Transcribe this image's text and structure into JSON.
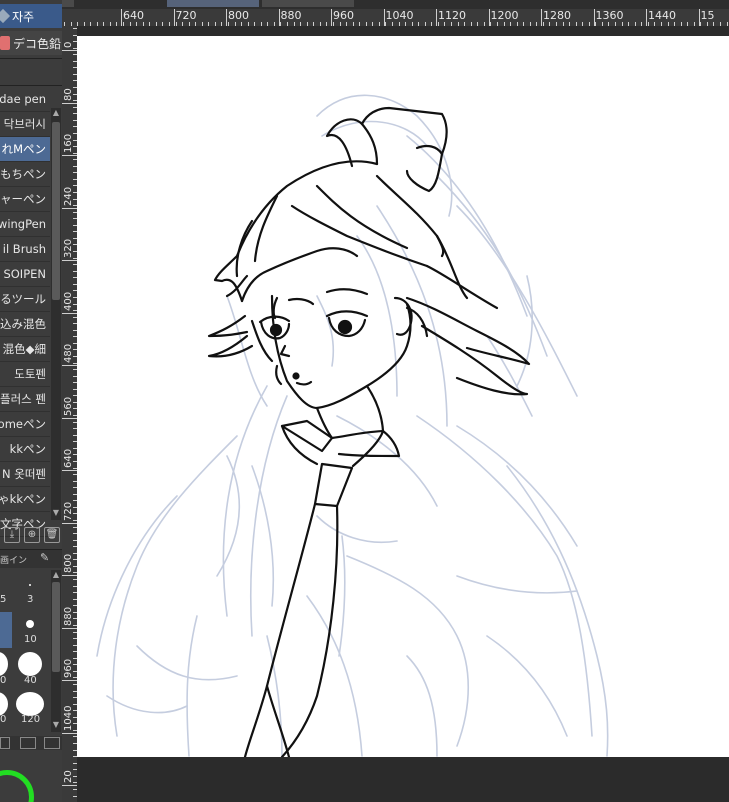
{
  "panel_tabs": {
    "top_label": "자주",
    "sub_label": "デコ色鉛"
  },
  "brushes": [
    {
      "label": "dae pen",
      "active": false
    },
    {
      "label": "닥브러시",
      "active": false
    },
    {
      "label": "れMペン",
      "active": true
    },
    {
      "label": "もちペン",
      "active": false
    },
    {
      "label": "ャーペン",
      "active": false
    },
    {
      "label": "wingPen",
      "active": false
    },
    {
      "label": "il Brush",
      "active": false
    },
    {
      "label": "SOIPEN",
      "active": false
    },
    {
      "label": "るツール",
      "active": false
    },
    {
      "label": "込み混色",
      "active": false
    },
    {
      "label": "混色◆細",
      "active": false
    },
    {
      "label": "도토펜",
      "active": false
    },
    {
      "label": "플러스 펜",
      "active": false
    },
    {
      "label": "omeペン",
      "active": false
    },
    {
      "label": "kkペン",
      "active": false
    },
    {
      "label": "N 옷떠펜",
      "active": false
    },
    {
      "label": "ゃkkペン",
      "active": false
    },
    {
      "label": "文字ペン",
      "active": false
    }
  ],
  "brush_size_panel": {
    "tab_label": "画イン",
    "sizes": [
      "5",
      "3",
      "10",
      "40",
      "0",
      "120",
      "0"
    ]
  },
  "ruler_top": [
    "640",
    "720",
    "800",
    "880",
    "960",
    "1040",
    "1120",
    "1200",
    "1280",
    "1360",
    "1440",
    "15"
  ],
  "ruler_left": [
    "0",
    "80",
    "160",
    "240",
    "320",
    "400",
    "480",
    "560",
    "640",
    "720",
    "800",
    "880",
    "960",
    "1040",
    "20"
  ],
  "colors": {
    "panel_bg": "#3c3c3c",
    "active_item": "#4d6a94",
    "tab_active": "#3a5a8a",
    "canvas": "#ffffff",
    "sketch_lines": "#c5cddf",
    "ink_lines": "#111111",
    "color_ring": "#22dd22"
  }
}
